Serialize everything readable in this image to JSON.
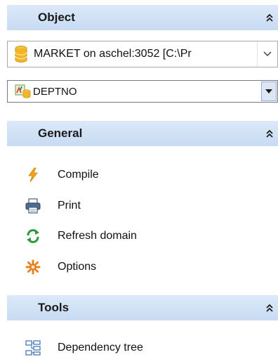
{
  "object_section": {
    "title": "Object",
    "database_combo": "MARKET on aschel:3052 [C:\\Pr",
    "domain_combo": "DEPTNO"
  },
  "general_section": {
    "title": "General",
    "items": [
      {
        "label": "Compile",
        "icon": "lightning-icon"
      },
      {
        "label": "Print",
        "icon": "printer-icon"
      },
      {
        "label": "Refresh domain",
        "icon": "refresh-icon"
      },
      {
        "label": "Options",
        "icon": "options-gear-icon"
      }
    ]
  },
  "tools_section": {
    "title": "Tools",
    "items": [
      {
        "label": "Dependency tree",
        "icon": "dependency-tree-icon"
      }
    ]
  },
  "colors": {
    "header_bg": "#c7dbf3",
    "combo_button_arrow": "#1a1a1a",
    "domain_button_bg": "#dce6f4"
  }
}
